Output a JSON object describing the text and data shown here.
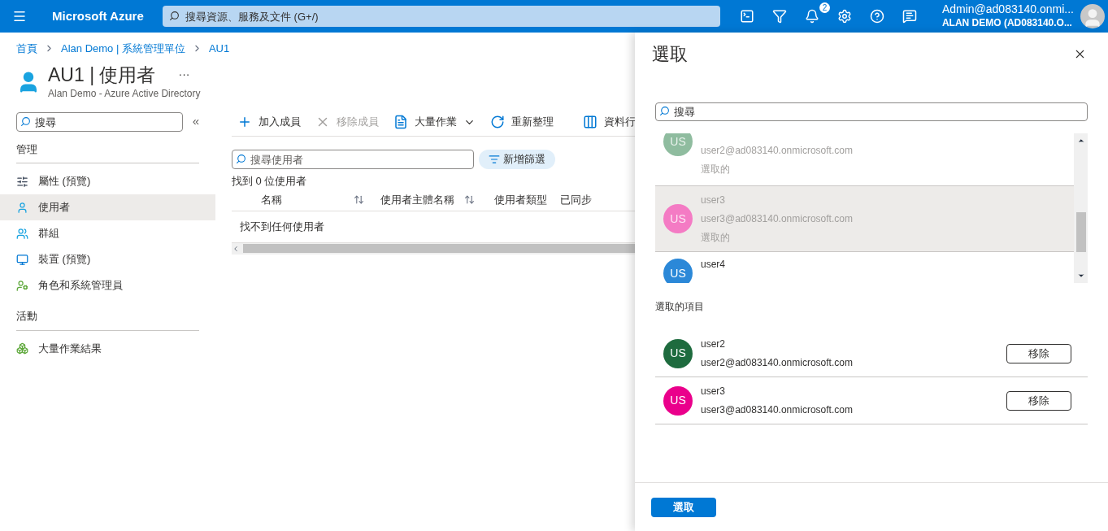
{
  "top_bar": {
    "brand": "Microsoft Azure",
    "search": {
      "placeholder": "搜尋資源、服務及文件 (G+/)"
    },
    "notifications_count": "2",
    "account": {
      "email": "Admin@ad083140.onmi...",
      "tenant": "ALAN DEMO (AD083140.O..."
    }
  },
  "breadcrumb": [
    "首頁",
    "Alan Demo | 系統管理單位",
    "AU1"
  ],
  "page": {
    "title": "AU1 | 使用者",
    "more": "···",
    "subtitle": "Alan Demo - Azure Active Directory"
  },
  "sidebar": {
    "search": {
      "placeholder": "搜尋"
    },
    "collapse": "«",
    "sections": [
      {
        "title": "管理",
        "items": [
          {
            "label": "屬性 (預覽)",
            "kind": "sliders",
            "selected": false
          },
          {
            "label": "使用者",
            "kind": "user",
            "selected": true
          },
          {
            "label": "群組",
            "kind": "group",
            "selected": false
          },
          {
            "label": "裝置 (預覽)",
            "kind": "device",
            "selected": false
          },
          {
            "label": "角色和系統管理員",
            "kind": "role",
            "selected": false
          }
        ]
      },
      {
        "title": "活動",
        "items": [
          {
            "label": "大量作業結果",
            "kind": "bulk",
            "selected": false
          }
        ]
      }
    ]
  },
  "toolbar": [
    {
      "label": "加入成員",
      "kind": "plus",
      "disabled": false
    },
    {
      "label": "移除成員",
      "kind": "x",
      "disabled": true
    },
    {
      "label": "大量作業",
      "kind": "doc",
      "disabled": false
    },
    {
      "label": "重新整理",
      "kind": "refresh",
      "disabled": false
    },
    {
      "kind": "divider"
    },
    {
      "label": "資料行",
      "kind": "columns",
      "disabled": false
    },
    {
      "kind": "divider"
    }
  ],
  "filter": {
    "search": {
      "placeholder": "搜尋使用者"
    },
    "add_filter": "新增篩選",
    "result_count": "找到 0 位使用者"
  },
  "table": {
    "columns": [
      {
        "label": "名稱",
        "sortable": true
      },
      {
        "label": "使用者主體名稱",
        "sortable": true
      },
      {
        "label": "使用者類型",
        "sortable": false
      },
      {
        "label": "已同步",
        "sortable": false
      }
    ],
    "empty_message": "找不到任何使用者"
  },
  "picker": {
    "title": "選取",
    "search": {
      "placeholder": "搜尋"
    },
    "results": [
      {
        "initials": "US",
        "email": "user2@ad083140.onmicrosoft.com",
        "status": "選取的",
        "selected": true,
        "highlighted": false,
        "color": "#8fbc9f"
      },
      {
        "initials": "US",
        "name": "user3",
        "email": "user3@ad083140.onmicrosoft.com",
        "status": "選取的",
        "selected": true,
        "highlighted": true,
        "color": "#f47bc4"
      },
      {
        "initials": "US",
        "name": "user4",
        "selected": false,
        "highlighted": false,
        "color": "#2b88d8"
      }
    ],
    "selected_title": "選取的項目",
    "selected_items": [
      {
        "initials": "US",
        "name": "user2",
        "email": "user2@ad083140.onmicrosoft.com",
        "remove": "移除",
        "color": "#1e6b3e"
      },
      {
        "initials": "US",
        "name": "user3",
        "email": "user3@ad083140.onmicrosoft.com",
        "remove": "移除",
        "color": "#ea008b"
      }
    ],
    "submit": "選取"
  }
}
